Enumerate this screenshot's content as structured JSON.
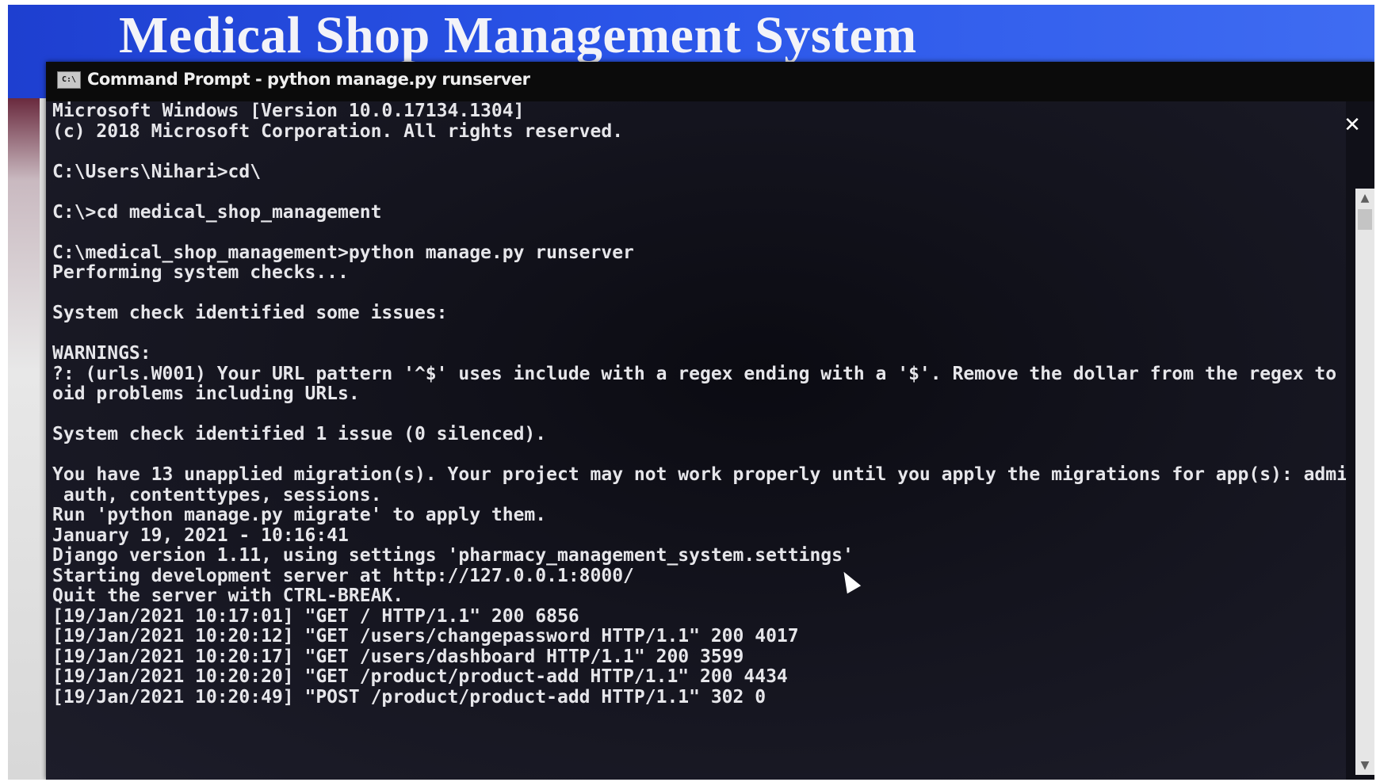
{
  "banner": {
    "title": "Medical Shop Management System"
  },
  "window": {
    "title": "Command Prompt - python manage.py runserver",
    "icon_label": "C:\\",
    "minimize_glyph": "─",
    "maximize_glyph": "☐",
    "close_glyph": "✕"
  },
  "console": {
    "lines": [
      "Microsoft Windows [Version 10.0.17134.1304]",
      "(c) 2018 Microsoft Corporation. All rights reserved.",
      "",
      "C:\\Users\\Nihari>cd\\",
      "",
      "C:\\>cd medical_shop_management",
      "",
      "C:\\medical_shop_management>python manage.py runserver",
      "Performing system checks...",
      "",
      "System check identified some issues:",
      "",
      "WARNINGS:",
      "?: (urls.W001) Your URL pattern '^$' uses include with a regex ending with a '$'. Remove the dollar from the regex to av",
      "oid problems including URLs.",
      "",
      "System check identified 1 issue (0 silenced).",
      "",
      "You have 13 unapplied migration(s). Your project may not work properly until you apply the migrations for app(s): admin,",
      " auth, contenttypes, sessions.",
      "Run 'python manage.py migrate' to apply them.",
      "January 19, 2021 - 10:16:41",
      "Django version 1.11, using settings 'pharmacy_management_system.settings'",
      "Starting development server at http://127.0.0.1:8000/",
      "Quit the server with CTRL-BREAK.",
      "[19/Jan/2021 10:17:01] \"GET / HTTP/1.1\" 200 6856",
      "[19/Jan/2021 10:20:12] \"GET /users/changepassword HTTP/1.1\" 200 4017",
      "[19/Jan/2021 10:20:17] \"GET /users/dashboard HTTP/1.1\" 200 3599",
      "[19/Jan/2021 10:20:20] \"GET /product/product-add HTTP/1.1\" 200 4434",
      "[19/Jan/2021 10:20:49] \"POST /product/product-add HTTP/1.1\" 302 0"
    ]
  },
  "scrollbar": {
    "up_glyph": "▲",
    "down_glyph": "▼"
  },
  "colors": {
    "banner": "#2a55e8",
    "console_bg": "#14141e",
    "console_text": "#e6e6ea",
    "titlebar": "#0b0b0b"
  }
}
